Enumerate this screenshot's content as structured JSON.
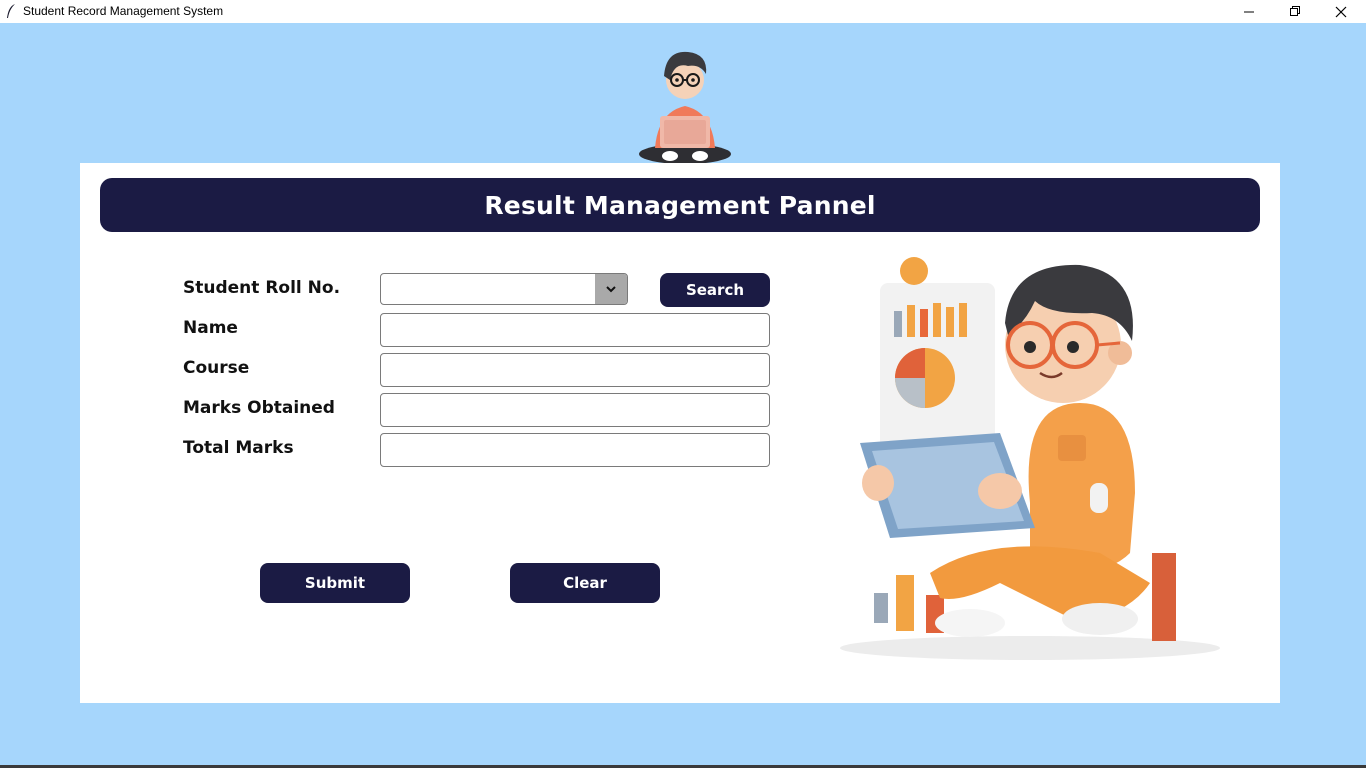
{
  "window": {
    "title": "Student Record Management System"
  },
  "panel": {
    "title": "Result Management Pannel"
  },
  "form": {
    "roll_label": "Student Roll No.",
    "roll_value": "",
    "search_label": "Search",
    "name_label": "Name",
    "name_value": "",
    "course_label": "Course",
    "course_value": "",
    "marks_label": "Marks Obtained",
    "marks_value": "",
    "total_label": "Total Marks",
    "total_value": ""
  },
  "actions": {
    "submit_label": "Submit",
    "clear_label": "Clear"
  },
  "colors": {
    "background": "#a6d6fc",
    "accent": "#1b1b44",
    "panel": "#ffffff"
  },
  "icons": {
    "app": "feather-icon",
    "minimize": "minimize-icon",
    "maximize": "restore-icon",
    "close": "close-icon",
    "dropdown": "chevron-down-icon"
  }
}
